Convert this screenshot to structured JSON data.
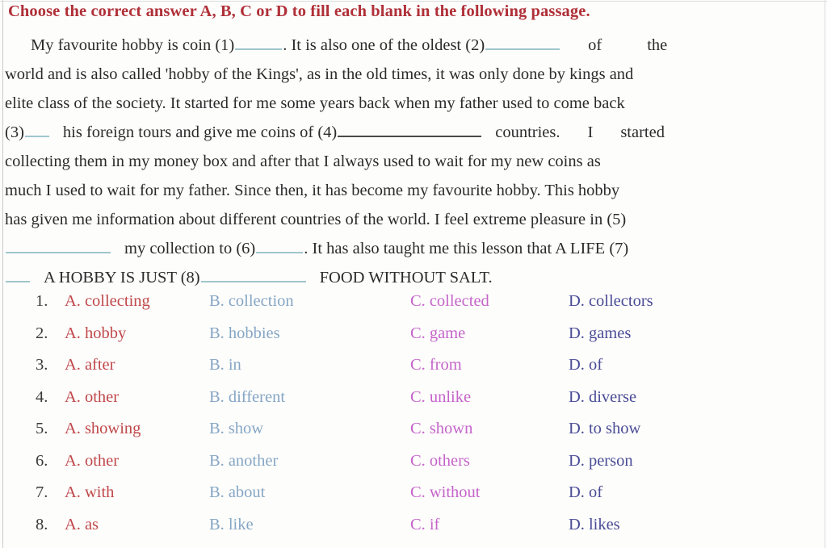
{
  "heading": "Choose the correct answer A, B, C or D to fill each blank in the following passage.",
  "passage": {
    "line1_a": "My favourite hobby is coin (1)",
    "line1_b": ". It is also one of the oldest (2)",
    "line1_c": "of",
    "line1_d": "the",
    "line2": "world and is also called 'hobby of the Kings', as in the old times, it was only done by kings and",
    "line3": "elite class of the society. It started for me some years back when my father used to come back",
    "line4_a": "(3)",
    "line4_b": "his foreign tours and give me coins of (4)",
    "line4_c": "countries.",
    "line4_d": "I",
    "line4_e": "started",
    "line5": "collecting them in my money box and after that I always used to wait for my new coins as",
    "line6": "much I used to wait for my father. Since then, it has become my favourite hobby. This hobby",
    "line7": "has given me information about different countries of the world. I feel extreme pleasure in (5)",
    "line8_a": "my collection to (6)",
    "line8_b": ". It has also taught me this lesson that A LIFE (7)",
    "line9_a": "A HOBBY IS JUST (8)",
    "line9_b": "FOOD WITHOUT SALT."
  },
  "options": {
    "letters": {
      "a": "A.",
      "b": "B.",
      "c": "C.",
      "d": "D."
    },
    "colors": {
      "a": "#c0484a",
      "b": "#86a6c4",
      "c": "#c564c9",
      "d": "#4a4c96",
      "heading": "#b03038",
      "number": "#3a3a3a",
      "blank": "#9fc6cb",
      "blank_dark": "#4a4a4a"
    },
    "rows": [
      {
        "num": "1.",
        "a": "collecting",
        "b": "collection",
        "c": "collected",
        "d": "collectors"
      },
      {
        "num": "2.",
        "a": "hobby",
        "b": "hobbies",
        "c": "game",
        "d": "games"
      },
      {
        "num": "3.",
        "a": "after",
        "b": "in",
        "c": "from",
        "d": "of"
      },
      {
        "num": "4.",
        "a": "other",
        "b": "different",
        "c": "unlike",
        "d": "diverse"
      },
      {
        "num": "5.",
        "a": "showing",
        "b": "show",
        "c": "shown",
        "d": "to show"
      },
      {
        "num": "6.",
        "a": "other",
        "b": "another",
        "c": "others",
        "d": "person"
      },
      {
        "num": "7.",
        "a": "with",
        "b": "about",
        "c": "without",
        "d": "of"
      },
      {
        "num": "8.",
        "a": "as",
        "b": "like",
        "c": "if",
        "d": "likes"
      }
    ]
  }
}
